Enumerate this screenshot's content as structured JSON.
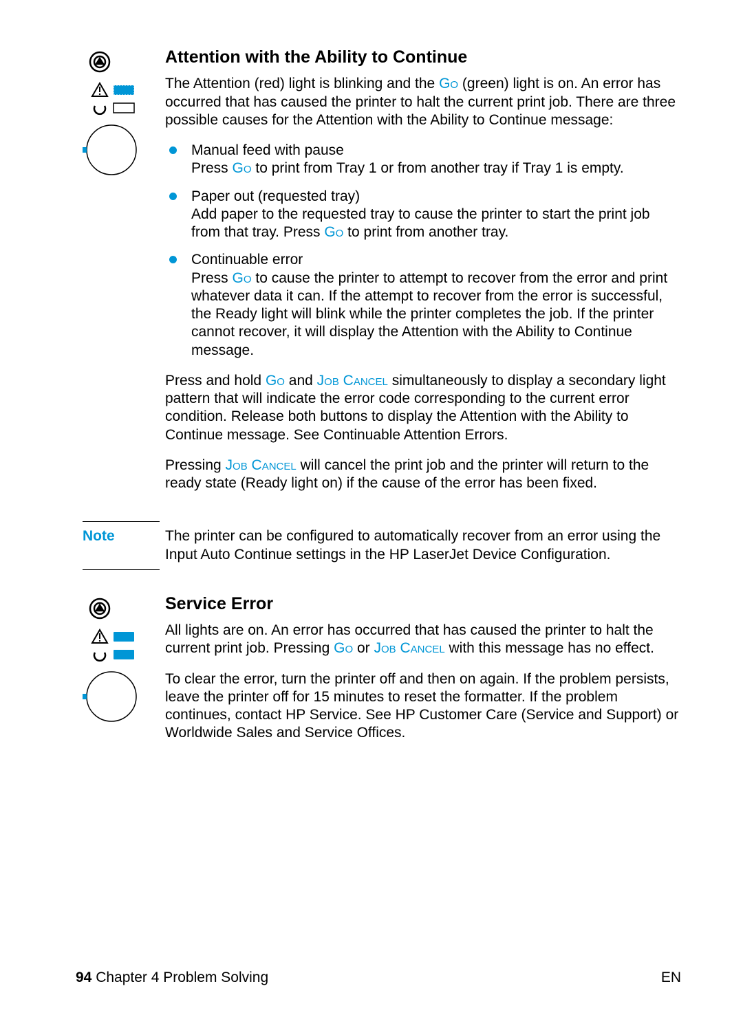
{
  "section1": {
    "heading": "Attention with the Ability to Continue",
    "intro_a": "The Attention (red) light is blinking and the ",
    "intro_go": "Go",
    "intro_b": " (green) light is on. An error has occurred that has caused the printer to halt the current print job. There are three possible causes for the Attention with the Ability to Continue message:",
    "items": [
      {
        "title": "Manual feed with pause",
        "body_a": "Press ",
        "body_go": "Go",
        "body_b": " to print from Tray 1 or from another tray if Tray 1 is empty."
      },
      {
        "title": "Paper out (requested tray)",
        "body_a": "Add paper to the requested tray to cause the printer to start the print job from that tray. Press ",
        "body_go": "Go",
        "body_b": " to print from another tray."
      },
      {
        "title": "Continuable error",
        "body_a": "Press ",
        "body_go": "Go",
        "body_b": " to cause the printer to attempt to recover from the error and print whatever data it can. If the attempt to recover from the error is successful, the Ready light will blink while the printer completes the job. If the printer cannot recover, it will display the Attention with the Ability to Continue message."
      }
    ],
    "para2_a": "Press and hold ",
    "para2_go": "Go",
    "para2_b": " and ",
    "para2_jc": "Job Cancel",
    "para2_c": " simultaneously to display a secondary light pattern that will indicate the error code corresponding to the current error condition. Release both buttons to display the Attention with the Ability to Continue message. See Continuable Attention Errors.",
    "para3_a": "Pressing ",
    "para3_jc": "Job Cancel",
    "para3_b": " will cancel the print job and the printer will return to the ready state (Ready light on) if the cause of the error has been fixed."
  },
  "note": {
    "label": "Note",
    "body": "The printer can be configured to automatically recover from an error using the Input Auto Continue settings in the HP LaserJet Device Configuration."
  },
  "section2": {
    "heading": "Service Error",
    "para1_a": "All lights are on. An error has occurred that has caused the printer to halt the current print job. Pressing ",
    "para1_go": "Go",
    "para1_b": " or ",
    "para1_jc": "Job Cancel",
    "para1_c": " with this message has no effect.",
    "para2": "To clear the error, turn the printer off and then on again. If the problem persists, leave the printer off for 15 minutes to reset the formatter. If the problem continues, contact HP Service. See HP Customer Care (Service and Support) or Worldwide Sales and Service Offices."
  },
  "footer": {
    "page_no": "94",
    "chapter": " Chapter 4 Problem Solving",
    "lang": "EN"
  }
}
